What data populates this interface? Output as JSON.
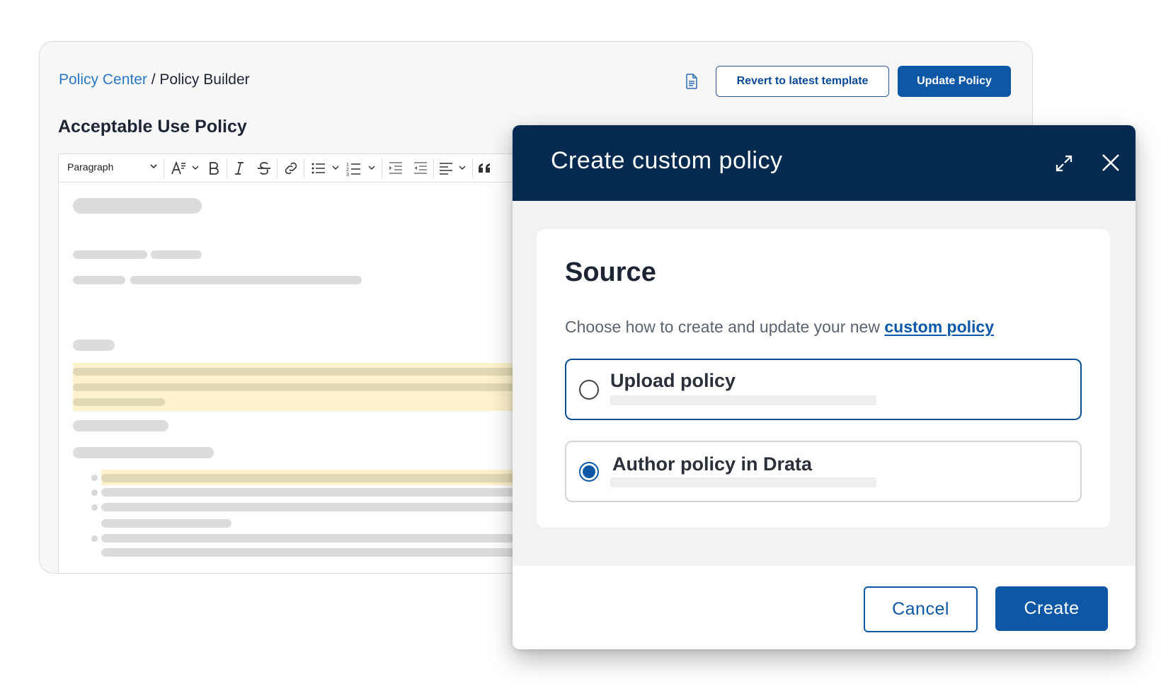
{
  "breadcrumb": {
    "parent": "Policy Center",
    "separator": " / ",
    "current": "Policy Builder"
  },
  "header_actions": {
    "revert_label": "Revert to latest template",
    "update_label": "Update Policy"
  },
  "policy": {
    "title": "Acceptable Use Policy"
  },
  "toolbar": {
    "block_style": "Paragraph",
    "icons": [
      "font-size-icon",
      "bold-icon",
      "italic-icon",
      "strikethrough-icon",
      "link-icon",
      "bulleted-list-icon",
      "numbered-list-icon",
      "indent-icon",
      "outdent-icon",
      "align-icon",
      "blockquote-icon"
    ]
  },
  "modal": {
    "title": "Create custom policy",
    "source": {
      "title": "Source",
      "description": "Choose how to create and update your new ",
      "description_link": "custom policy"
    },
    "options": [
      {
        "label": "Upload policy",
        "selected": false
      },
      {
        "label": "Author policy in Drata",
        "selected": true
      }
    ],
    "cancel_label": "Cancel",
    "create_label": "Create"
  },
  "colors": {
    "primary": "#0d57a5",
    "modal_header": "#052a4f",
    "link": "#2b78c5",
    "highlight": "#fdf2cc"
  }
}
